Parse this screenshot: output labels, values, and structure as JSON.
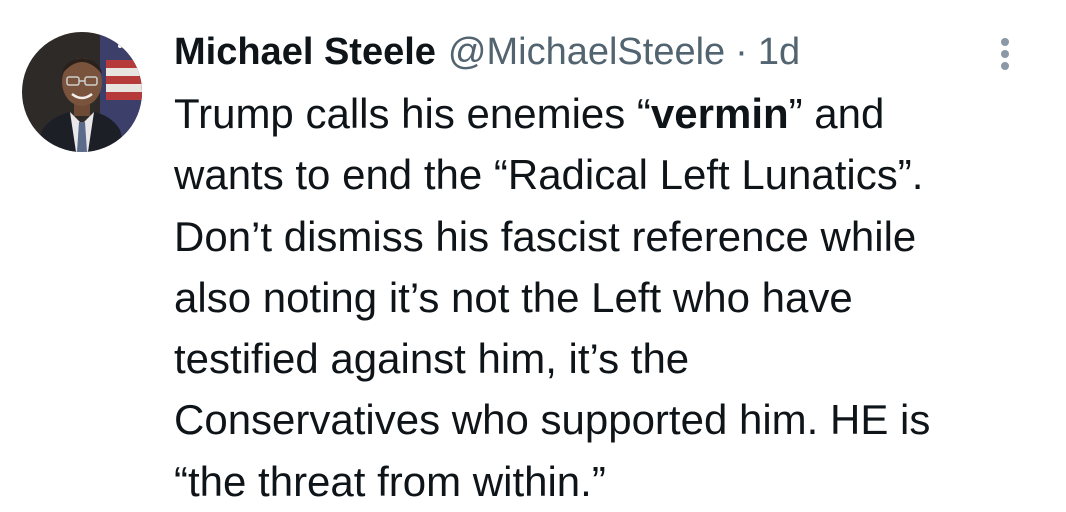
{
  "author": {
    "name": "Michael Steele",
    "handle": "@MichaelSteele",
    "separator": "·",
    "time": "1d"
  },
  "more_icon": "more-vertical-icon",
  "colors": {
    "text": "#0f1419",
    "secondary": "#536471",
    "icon": "#8b98a5",
    "background": "#ffffff"
  },
  "tweet": {
    "line1_before": "Trump calls his enemies “",
    "line1_bold": "vermin",
    "line1_after": "” and",
    "line2": "wants to end the “Radical Left Lunatics”.",
    "line3": "Don’t dismiss his fascist reference while",
    "line4": "also noting it’s not the Left who have",
    "line5": "testified against him, it’s the",
    "line6": "Conservatives who supported him. HE is",
    "line7": "“the threat from within.”"
  }
}
